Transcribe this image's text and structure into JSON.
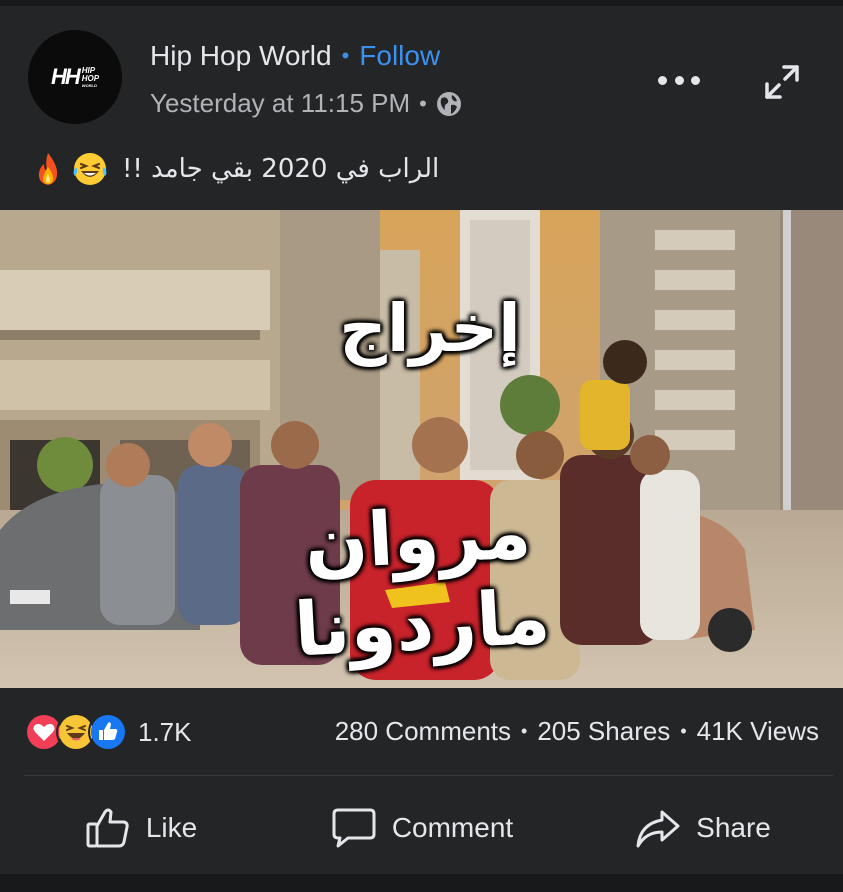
{
  "post": {
    "page_name": "Hip Hop World",
    "follow_label": "Follow",
    "timestamp": "Yesterday at 11:15 PM",
    "privacy_icon": "globe-icon",
    "avatar": {
      "logo_letters": "HH",
      "logo_line1": "HIP",
      "logo_line2": "HOP",
      "logo_line3": "WORLD"
    },
    "caption": "الراب في 2020 بقي جامد !!",
    "caption_emojis": [
      "fire-emoji",
      "laughing-tears-emoji"
    ]
  },
  "video": {
    "overlay_title": "إخراج",
    "overlay_name": "مروان ماردونا"
  },
  "engagement": {
    "reactions": [
      "love",
      "haha",
      "like"
    ],
    "reaction_count": "1.7K",
    "comments": "280 Comments",
    "shares": "205 Shares",
    "views": "41K Views"
  },
  "actions": {
    "like": "Like",
    "comment": "Comment",
    "share": "Share"
  },
  "colors": {
    "background": "#242526",
    "accent": "#3b90f0",
    "text": "#e4e6eb",
    "secondary_text": "#b0b3b8"
  }
}
